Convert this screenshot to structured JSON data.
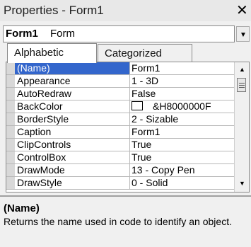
{
  "window": {
    "title": "Properties - Form1",
    "close_glyph": "✕"
  },
  "object_selector": {
    "name": "Form1",
    "type": "Form",
    "arrow_glyph": "▼"
  },
  "tabs": [
    {
      "label": "Alphabetic",
      "active": true
    },
    {
      "label": "Categorized",
      "active": false
    }
  ],
  "properties": [
    {
      "name": "(Name)",
      "value": "Form1",
      "selected": true
    },
    {
      "name": "Appearance",
      "value": "1 - 3D"
    },
    {
      "name": "AutoRedraw",
      "value": "False"
    },
    {
      "name": "BackColor",
      "value": "&H8000000F",
      "swatch": "#ffffff"
    },
    {
      "name": "BorderStyle",
      "value": "2 - Sizable"
    },
    {
      "name": "Caption",
      "value": "Form1"
    },
    {
      "name": "ClipControls",
      "value": "True"
    },
    {
      "name": "ControlBox",
      "value": "True"
    },
    {
      "name": "DrawMode",
      "value": "13 - Copy Pen"
    },
    {
      "name": "DrawStyle",
      "value": "0 - Solid"
    }
  ],
  "scrollbar": {
    "up_glyph": "▲",
    "down_glyph": "▼"
  },
  "description": {
    "title": "(Name)",
    "text": "Returns the name used in code to identify an object."
  },
  "colors": {
    "selection": "#3366cc",
    "background": "#f0f0f0"
  }
}
